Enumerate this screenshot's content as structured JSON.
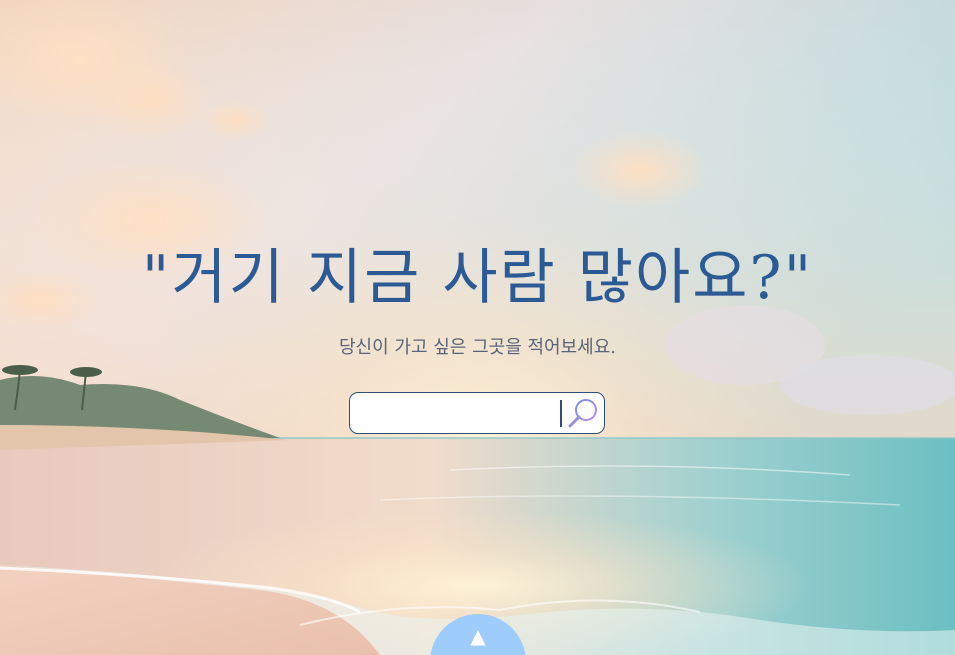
{
  "hero": {
    "headline": "\"거기 지금 사람 많아요?\"",
    "subtitle": "당신이 가고 싶은 그곳을 적어보세요."
  },
  "search": {
    "value": "",
    "placeholder": "",
    "icon": "magnifier-icon"
  },
  "scroll_up": {
    "glyph": "▲",
    "icon": "triangle-up-icon"
  },
  "colors": {
    "headline": "#2b5a94",
    "subtitle": "#5a6478",
    "search_border": "#2e4f78",
    "scroll_button": "#9fcdfb"
  }
}
